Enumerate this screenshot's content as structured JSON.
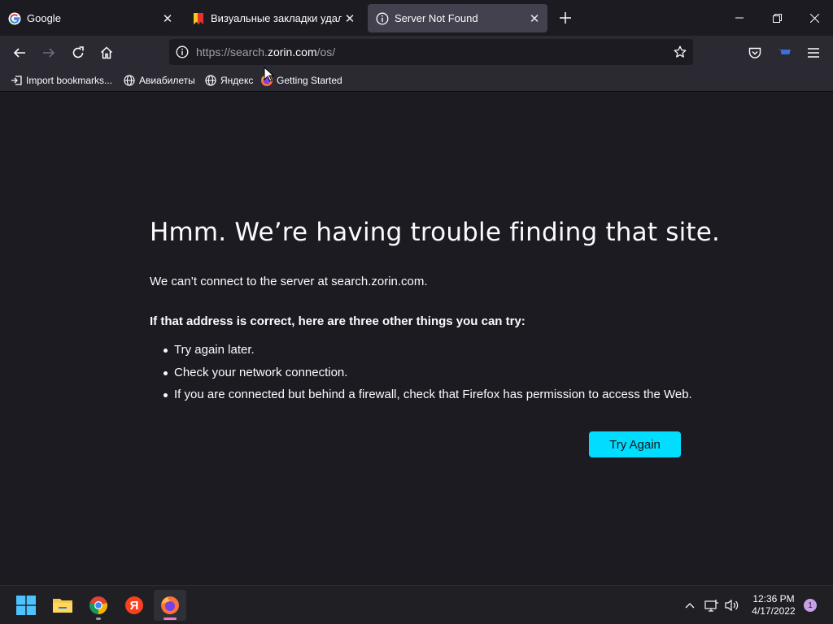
{
  "tabs": [
    {
      "title": "Google",
      "favicon": "google-g-icon"
    },
    {
      "title": "Визуальные закладки удалены",
      "favicon": "bookmark-flag-icon"
    },
    {
      "title": "Server Not Found",
      "favicon": "info-icon",
      "active": true
    }
  ],
  "url": {
    "prefix": "https://search.",
    "host": "zorin.com",
    "path": "/os/"
  },
  "bookmarks": [
    {
      "label": "Import bookmarks...",
      "icon": "import-icon"
    },
    {
      "label": "Авиабилеты",
      "icon": "globe-icon"
    },
    {
      "label": "Яндекс",
      "icon": "globe-icon"
    },
    {
      "label": "Getting Started",
      "icon": "firefox-icon"
    }
  ],
  "error": {
    "title": "Hmm. We’re having trouble finding that site.",
    "description": "We can’t connect to the server at search.zorin.com.",
    "subtitle": "If that address is correct, here are three other things you can try:",
    "suggestions": [
      "Try again later.",
      "Check your network connection.",
      "If you are connected but behind a firewall, check that Firefox has permission to access the Web."
    ],
    "button": "Try Again"
  },
  "taskbar": {
    "apps": [
      "windows-start-icon",
      "file-explorer-icon",
      "chrome-icon",
      "yandex-icon",
      "firefox-icon"
    ],
    "time": "12:36 PM",
    "date": "4/17/2022",
    "notifications": "1"
  },
  "colors": {
    "accent": "#00ddff",
    "bg": "#1c1b22",
    "toolbar": "#2b2a33",
    "active_tab": "#42414d"
  }
}
